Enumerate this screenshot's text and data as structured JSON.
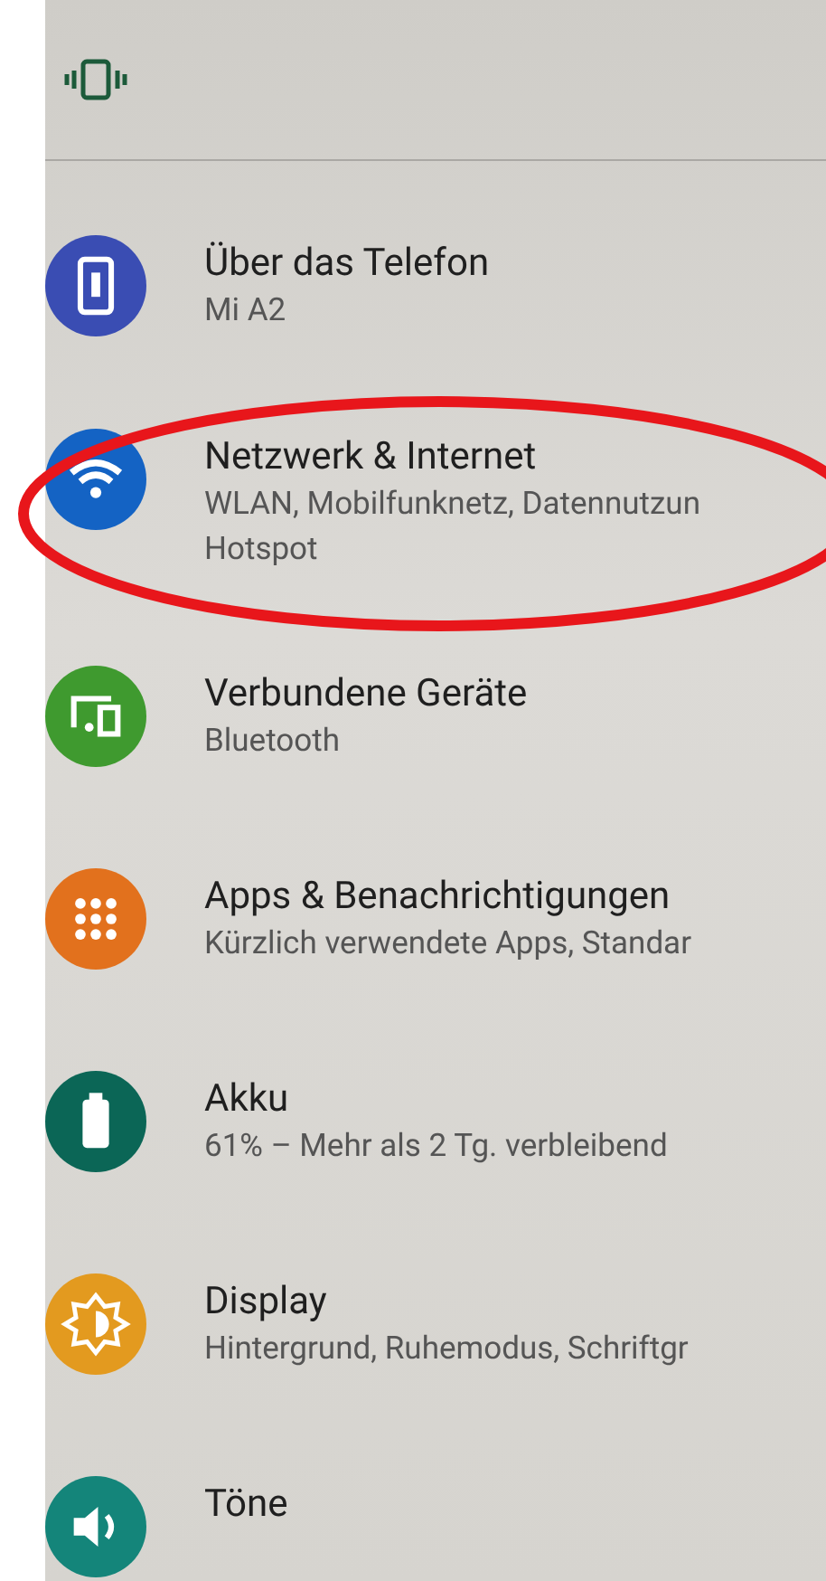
{
  "items": [
    {
      "title": "Über das Telefon",
      "subtitle": "Mi A2",
      "kind": "info",
      "color": "#3a4db3",
      "highlighted": false
    },
    {
      "title": "Netzwerk & Internet",
      "subtitle": "WLAN, Mobilfunknetz, Datennutzun\nHotspot",
      "kind": "wifi",
      "color": "#1463c4",
      "highlighted": true
    },
    {
      "title": "Verbundene Geräte",
      "subtitle": "Bluetooth",
      "kind": "devices",
      "color": "#3f9a2f",
      "highlighted": false
    },
    {
      "title": "Apps & Benachrichtigungen",
      "subtitle": "Kürzlich verwendete Apps, Standar",
      "kind": "apps",
      "color": "#e2711d",
      "highlighted": false
    },
    {
      "title": "Akku",
      "subtitle": "61% – Mehr als 2 Tg. verbleibend",
      "kind": "battery",
      "color": "#0b6656",
      "highlighted": false
    },
    {
      "title": "Display",
      "subtitle": "Hintergrund, Ruhemodus, Schriftgr",
      "kind": "display",
      "color": "#e39a1f",
      "highlighted": false
    },
    {
      "title": "Töne",
      "kind": "sound",
      "color": "#14857a",
      "highlighted": false
    }
  ]
}
